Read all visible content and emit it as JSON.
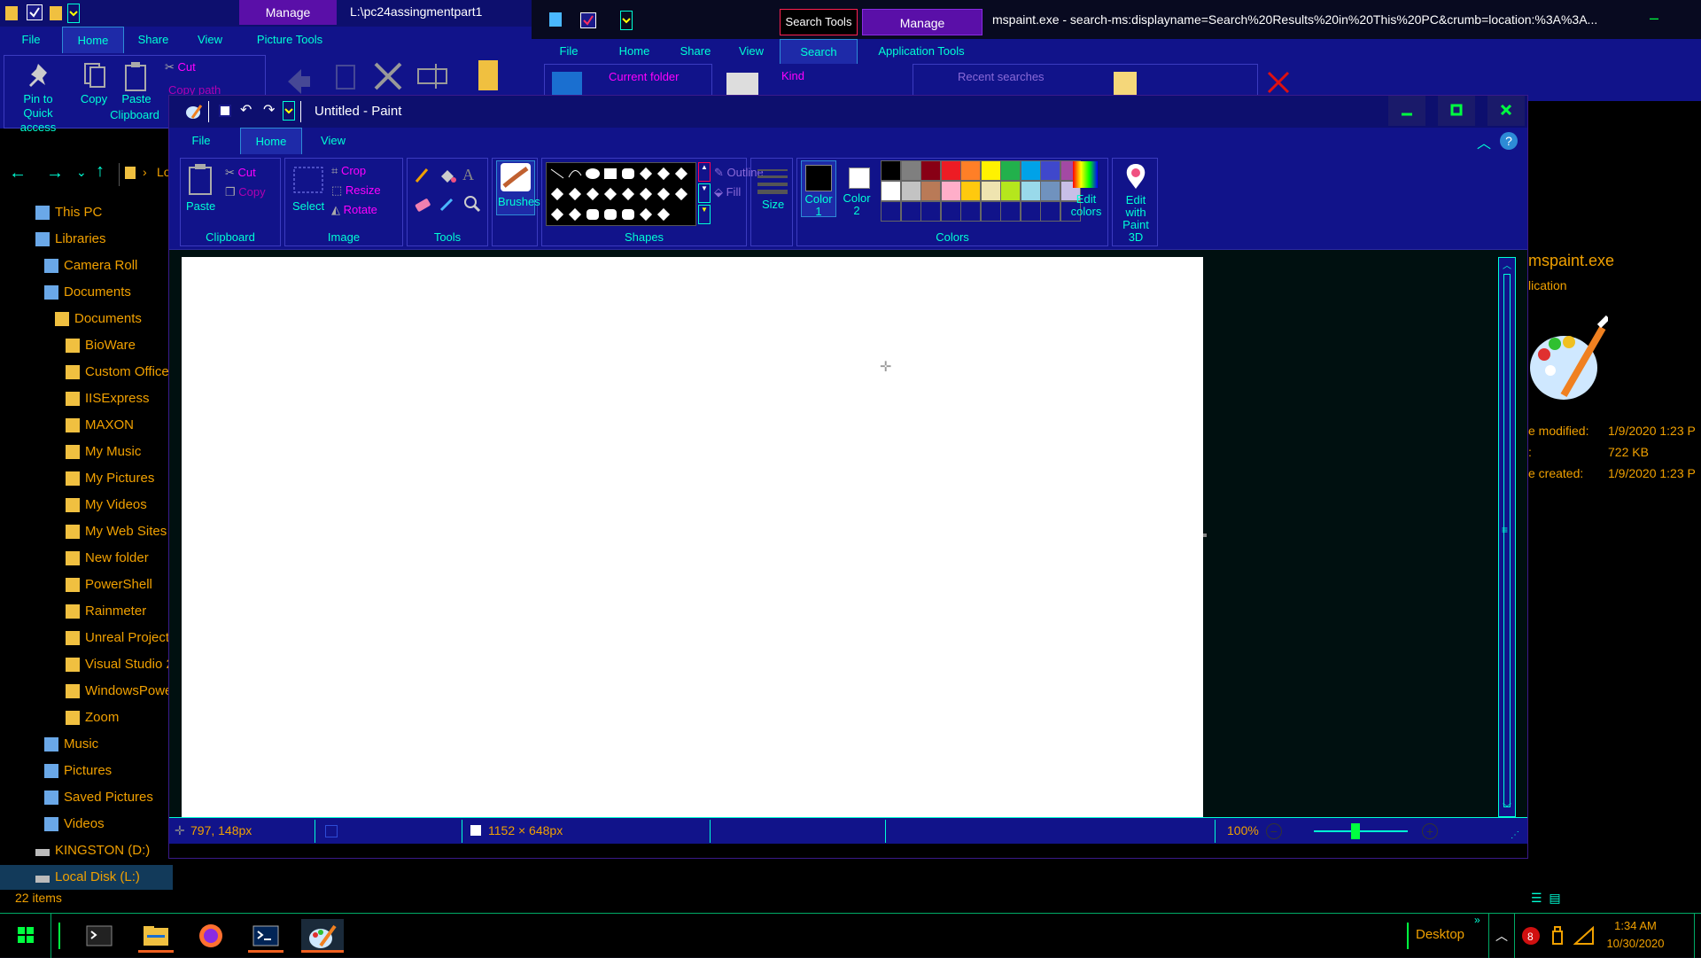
{
  "explorer_left": {
    "manage_tab": "Manage",
    "title": "L:\\pc24assingmentpart1",
    "tabs": [
      "File",
      "Home",
      "Share",
      "View",
      "Picture Tools"
    ],
    "active_tab": "Home",
    "ribbon": {
      "pin_label": "Pin to Quick access",
      "copy_label": "Copy",
      "paste_label": "Paste",
      "cut_label": "Cut",
      "copy_path_label": "Copy path",
      "group_label": "Clipboard"
    },
    "nav_partial": "Lo",
    "tree": [
      {
        "label": "This PC",
        "icon": "computer-icon"
      },
      {
        "label": "Libraries",
        "icon": "libraries-icon"
      },
      {
        "label": "Camera Roll",
        "icon": "library-icon"
      },
      {
        "label": "Documents",
        "icon": "library-icon"
      },
      {
        "label": "Documents",
        "icon": "folder-doc-icon"
      },
      {
        "label": "BioWare",
        "icon": "folder-icon"
      },
      {
        "label": "Custom Office",
        "icon": "folder-icon"
      },
      {
        "label": "IISExpress",
        "icon": "folder-icon"
      },
      {
        "label": "MAXON",
        "icon": "folder-icon"
      },
      {
        "label": "My Music",
        "icon": "music-folder-icon"
      },
      {
        "label": "My Pictures",
        "icon": "pictures-folder-icon"
      },
      {
        "label": "My Videos",
        "icon": "videos-folder-icon"
      },
      {
        "label": "My Web Sites",
        "icon": "folder-icon"
      },
      {
        "label": "New folder",
        "icon": "folder-icon"
      },
      {
        "label": "PowerShell",
        "icon": "folder-icon"
      },
      {
        "label": "Rainmeter",
        "icon": "folder-icon"
      },
      {
        "label": "Unreal Projects",
        "icon": "folder-icon"
      },
      {
        "label": "Visual Studio 2",
        "icon": "folder-icon"
      },
      {
        "label": "WindowsPowe",
        "icon": "folder-icon"
      },
      {
        "label": "Zoom",
        "icon": "folder-icon"
      },
      {
        "label": "Music",
        "icon": "library-icon"
      },
      {
        "label": "Pictures",
        "icon": "library-icon"
      },
      {
        "label": "Saved Pictures",
        "icon": "library-icon"
      },
      {
        "label": "Videos",
        "icon": "library-icon"
      },
      {
        "label": "KINGSTON (D:)",
        "icon": "drive-icon"
      },
      {
        "label": "Local Disk (L:)",
        "icon": "drive-icon"
      }
    ],
    "items_count": "22 items"
  },
  "explorer_right": {
    "search_tools_tab": "Search Tools",
    "manage_tab": "Manage",
    "title": "mspaint.exe - search-ms:displayname=Search%20Results%20in%20This%20PC&crumb=location:%3A%3A...",
    "tabs": [
      "File",
      "Home",
      "Share",
      "View",
      "Search",
      "Application Tools"
    ],
    "active_tab": "Search",
    "ribbon": {
      "current_folder": "Current folder",
      "kind": "Kind",
      "recent_searches": "Recent searches"
    },
    "details": {
      "filename": "mspaint.exe",
      "type_partial": "lication",
      "modified_label": "e modified:",
      "modified_value": "1/9/2020 1:23 P",
      "size_label": ":",
      "size_value": "722 KB",
      "created_label": "e created:",
      "created_value": "1/9/2020 1:23 P"
    }
  },
  "paint": {
    "title": "Untitled - Paint",
    "tabs": [
      "File",
      "Home",
      "View"
    ],
    "active_tab": "Home",
    "clipboard": {
      "paste": "Paste",
      "cut": "Cut",
      "copy": "Copy",
      "group": "Clipboard"
    },
    "image": {
      "select": "Select",
      "crop": "Crop",
      "resize": "Resize",
      "rotate": "Rotate",
      "group": "Image"
    },
    "tools_group": "Tools",
    "brushes": "Brushes",
    "shapes_group": "Shapes",
    "outline": "Outline",
    "fill": "Fill",
    "size": "Size",
    "color1": "Color 1",
    "color2": "Color 2",
    "edit_colors": "Edit colors",
    "colors_group": "Colors",
    "edit_paint3d": "Edit with Paint 3D",
    "palette_row1": [
      "#000000",
      "#7f7f7f",
      "#880015",
      "#ed1c24",
      "#ff7f27",
      "#fff200",
      "#22b14c",
      "#00a2e8",
      "#3f48cc",
      "#a349a4"
    ],
    "palette_row2": [
      "#ffffff",
      "#c3c3c3",
      "#b97a57",
      "#ffaec9",
      "#ffc90e",
      "#efe4b0",
      "#b5e61d",
      "#99d9ea",
      "#7092be",
      "#c8bfe7"
    ],
    "color1_value": "#000000",
    "color2_value": "#ffffff",
    "status": {
      "cursor_pos": "797, 148px",
      "canvas_size": "1152 × 648px",
      "zoom": "100%"
    }
  },
  "taskbar": {
    "desktop_label": "Desktop",
    "time": "1:34 AM",
    "date": "10/30/2020"
  }
}
